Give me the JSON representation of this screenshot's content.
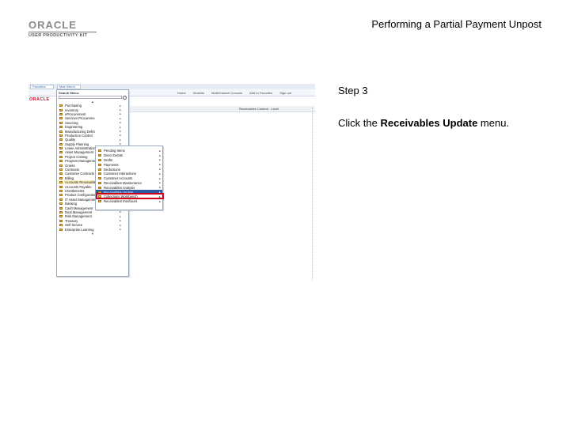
{
  "header": {
    "logo_oracle": "ORACLE",
    "logo_sub": "USER PRODUCTIVITY KIT",
    "doc_title": "Performing a Partial Payment Unpost"
  },
  "step": {
    "label": "Step 3",
    "instruction_prefix": "Click the ",
    "instruction_target": "Receivables Update",
    "instruction_suffix": " menu."
  },
  "screenshot": {
    "tabs": [
      "Favorites",
      "Main Menu"
    ],
    "brand": "ORACLE",
    "nav_links": [
      "Home",
      "Worklist",
      "MultiChannel Console",
      "Add to Favorites",
      "Sign out"
    ],
    "content_title": "Receivables Content - Level",
    "main_menu": {
      "search_label": "Search Menu:",
      "items": [
        "Purchasing",
        "Inventory",
        "eProcurement",
        "Services Procurement",
        "Sourcing",
        "Engineering",
        "Manufacturing Definitions",
        "Production Control",
        "Quality",
        "Supply Planning",
        "Lease Administration",
        "Asset Management",
        "Project Costing",
        "Program Management",
        "Grants",
        "Contracts",
        "Customer Contracts",
        "Billing",
        "Accounts Receivable",
        "Accounts Payable",
        "eSettlements",
        "Product Configurator",
        "IT Asset Management",
        "Banking",
        "Cash Management",
        "Deal Management",
        "Risk Management",
        "Treasury",
        "Self Service",
        "Enterprise Learning"
      ],
      "highlighted_item": "Accounts Receivable"
    },
    "sub_menu": {
      "items": [
        "Pending Items",
        "Direct Debits",
        "Drafts",
        "Payments",
        "Deductions",
        "Customer Interactions",
        "Customer Accounts",
        "Receivables Maintenance",
        "Receivables Analysis",
        "Receivables Update",
        "Collections Workbench",
        "Receivables Interfaces"
      ],
      "selected_item": "Receivables Update"
    }
  }
}
